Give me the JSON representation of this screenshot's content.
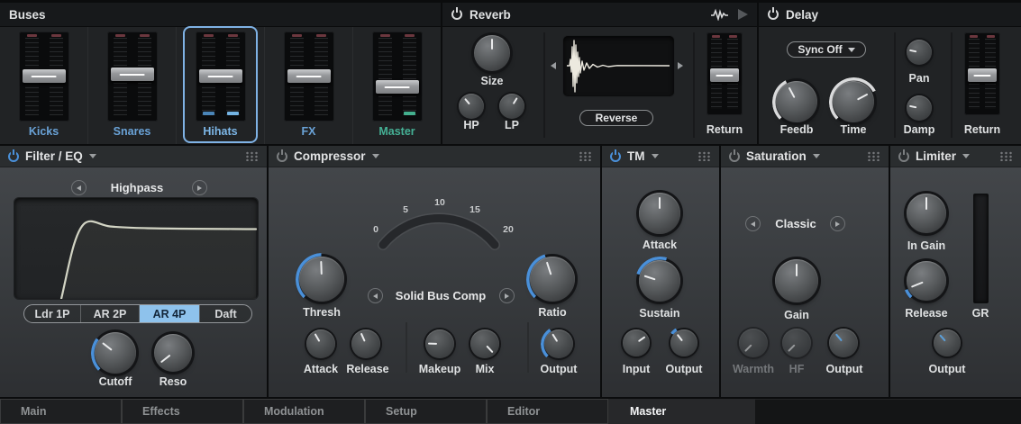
{
  "colors": {
    "accent_blue": "#4a90d9",
    "arc_white": "#d9dadb",
    "power_on": "#4a90d9",
    "power_off": "#7b7e80",
    "power_white": "#d8d9da",
    "selection_ring": "#7fb2e5",
    "segment_active_bg": "#8ec2ec"
  },
  "buses": {
    "title": "Buses",
    "channels": [
      {
        "label": "Kicks",
        "color": "#6aa3d8",
        "handle_top": "42%"
      },
      {
        "label": "Snares",
        "color": "#6aa3d8",
        "handle_top": "40%"
      },
      {
        "label": "Hihats",
        "color": "#7db7e8",
        "handle_top": "42%",
        "selected": true,
        "meter_l": "#4a85b8",
        "meter_r": "#74b4e4"
      },
      {
        "label": "FX",
        "color": "#6aa3d8",
        "handle_top": "42%"
      },
      {
        "label": "Master",
        "color": "#45b095",
        "handle_top": "54%",
        "meter_r": "#43b08e"
      }
    ]
  },
  "reverb": {
    "title": "Reverb",
    "power_color": "#d8d9da",
    "size": {
      "label": "Size",
      "angle": "0deg"
    },
    "hp": {
      "label": "HP",
      "angle": "-40deg"
    },
    "lp": {
      "label": "LP",
      "angle": "32deg"
    },
    "reverse_label": "Reverse",
    "return_label": "Return",
    "return_handle_top": "44%"
  },
  "delay": {
    "title": "Delay",
    "power_color": "#d8d9da",
    "sync_label": "Sync Off",
    "feedb": {
      "label": "Feedb",
      "angle": "-28deg",
      "arc_from": "-135deg",
      "arc_span": "107deg",
      "arc_color": "#d9dadb"
    },
    "time": {
      "label": "Time",
      "angle": "62deg",
      "arc_from": "-135deg",
      "arc_span": "197deg",
      "arc_color": "#d9dadb"
    },
    "pan": {
      "label": "Pan",
      "angle": "-78deg"
    },
    "damp": {
      "label": "Damp",
      "angle": "-78deg"
    },
    "return_label": "Return",
    "return_handle_top": "44%"
  },
  "filter": {
    "title": "Filter / EQ",
    "power_color": "#4a90d9",
    "mode": "Highpass",
    "segments": [
      "Ldr 1P",
      "AR 2P",
      "AR 4P",
      "Daft"
    ],
    "active_segment": "AR 4P",
    "cutoff": {
      "label": "Cutoff",
      "angle": "-52deg",
      "arc_from": "-135deg",
      "arc_span": "83deg",
      "arc_color": "#4a90d9"
    },
    "reso": {
      "label": "Reso",
      "angle": "-128deg"
    }
  },
  "compressor": {
    "title": "Compressor",
    "power_color": "#7b7e80",
    "gauge_ticks": [
      "0",
      "5",
      "10",
      "15",
      "20"
    ],
    "model": "Solid Bus Comp",
    "thresh": {
      "label": "Thresh",
      "angle": "-2deg",
      "arc_from": "-135deg",
      "arc_span": "133deg",
      "arc_color": "#4a90d9"
    },
    "ratio": {
      "label": "Ratio",
      "angle": "-18deg",
      "arc_from": "-135deg",
      "arc_span": "117deg",
      "arc_color": "#4a90d9"
    },
    "attack": {
      "label": "Attack",
      "angle": "-30deg"
    },
    "release": {
      "label": "Release",
      "angle": "-24deg"
    },
    "makeup": {
      "label": "Makeup",
      "angle": "-88deg"
    },
    "mix": {
      "label": "Mix",
      "angle": "137deg"
    },
    "output": {
      "label": "Output",
      "angle": "-32deg",
      "arc_from": "-135deg",
      "arc_span": "103deg",
      "arc_color": "#4a90d9"
    }
  },
  "tm": {
    "title": "TM",
    "power_color": "#4a90d9",
    "attack": {
      "label": "Attack",
      "angle": "0deg"
    },
    "sustain": {
      "label": "Sustain",
      "angle": "-72deg",
      "arc_from": "-72deg",
      "arc_span": "88deg",
      "arc_color": "#4a90d9"
    },
    "input": {
      "label": "Input",
      "angle": "55deg"
    },
    "output": {
      "label": "Output",
      "angle": "-38deg",
      "arc_from": "-52deg",
      "arc_span": "22deg",
      "arc_color": "#4a90d9"
    }
  },
  "saturation": {
    "title": "Saturation",
    "power_color": "#7b7e80",
    "mode": "Classic",
    "gain": {
      "label": "Gain",
      "angle": "0deg"
    },
    "warmth": {
      "label": "Warmth",
      "angle": "-135deg"
    },
    "hf": {
      "label": "HF",
      "angle": "-135deg"
    },
    "output": {
      "label": "Output",
      "angle": "-40deg",
      "indicator_color": "#5b9fd8"
    }
  },
  "limiter": {
    "title": "Limiter",
    "power_color": "#7b7e80",
    "in_gain": {
      "label": "In Gain",
      "angle": "0deg"
    },
    "release": {
      "label": "Release",
      "angle": "-112deg",
      "arc_from": "-135deg",
      "arc_span": "23deg",
      "arc_color": "#4a90d9"
    },
    "gr_label": "GR",
    "output": {
      "label": "Output",
      "angle": "-42deg",
      "indicator_color": "#5b9fd8"
    }
  },
  "tabs": {
    "items": [
      "Main",
      "Effects",
      "Modulation",
      "Setup",
      "Editor",
      "Master"
    ],
    "active": "Master"
  }
}
